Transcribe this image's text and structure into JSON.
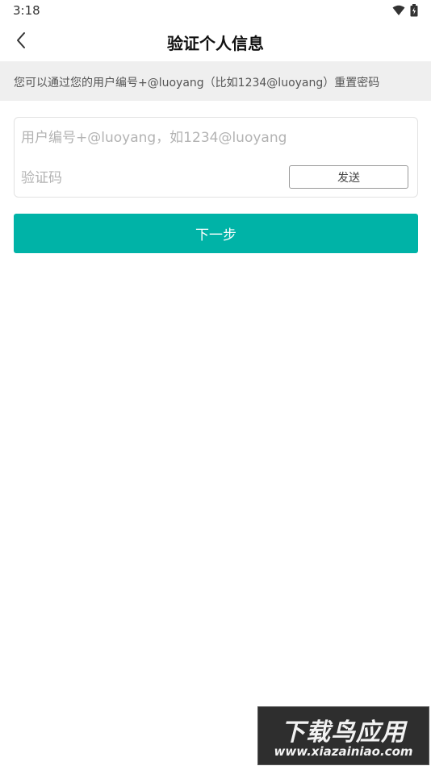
{
  "status_bar": {
    "time": "3:18",
    "icons": [
      "wifi-icon",
      "battery-icon"
    ]
  },
  "header": {
    "back_icon": "chevron-left-icon",
    "title": "验证个人信息"
  },
  "info_banner": {
    "text": "您可以通过您的用户编号+@luoyang（比如1234@luoyang）重置密码"
  },
  "form": {
    "user_field": {
      "value": "",
      "placeholder": "用户编号+@luoyang，如1234@luoyang"
    },
    "code_field": {
      "value": "",
      "placeholder": "验证码"
    },
    "send_label": "发送"
  },
  "next_label": "下一步",
  "watermark": {
    "title": "下载鸟应用",
    "url": "www.xiazainiao.com"
  },
  "colors": {
    "accent": "#00b3a7",
    "banner_bg": "#efefef",
    "watermark_bg": "#2e2e2e"
  }
}
